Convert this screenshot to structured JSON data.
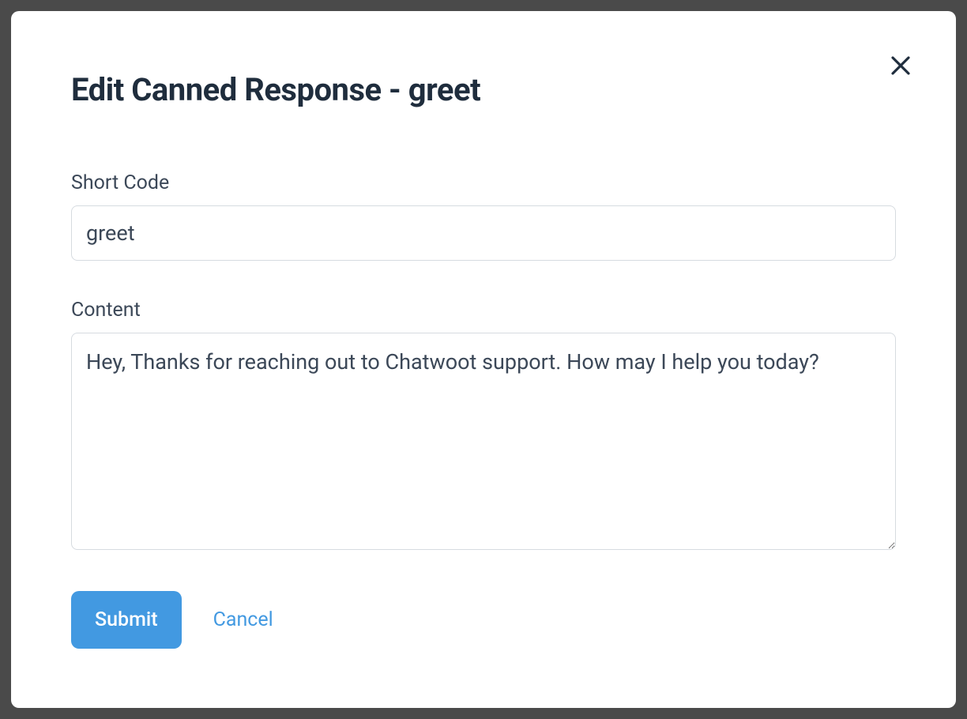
{
  "modal": {
    "title": "Edit Canned Response - greet"
  },
  "form": {
    "short_code": {
      "label": "Short Code",
      "value": "greet"
    },
    "content": {
      "label": "Content",
      "value": "Hey, Thanks for reaching out to Chatwoot support. How may I help you today?"
    }
  },
  "buttons": {
    "submit": "Submit",
    "cancel": "Cancel"
  }
}
